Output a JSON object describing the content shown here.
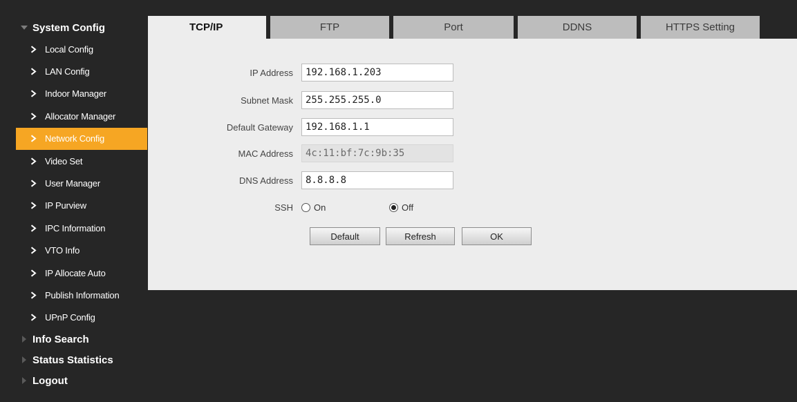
{
  "sidebar": {
    "system_config": "System Config",
    "items": [
      {
        "label": "Local Config"
      },
      {
        "label": "LAN Config"
      },
      {
        "label": "Indoor Manager"
      },
      {
        "label": "Allocator Manager"
      },
      {
        "label": "Network Config"
      },
      {
        "label": "Video Set"
      },
      {
        "label": "User Manager"
      },
      {
        "label": "IP Purview"
      },
      {
        "label": "IPC Information"
      },
      {
        "label": "VTO Info"
      },
      {
        "label": "IP Allocate Auto"
      },
      {
        "label": "Publish Information"
      },
      {
        "label": "UPnP Config"
      }
    ],
    "active_item": "Network Config",
    "info_search": "Info Search",
    "status_statistics": "Status Statistics",
    "logout": "Logout"
  },
  "tabs": [
    {
      "label": "TCP/IP"
    },
    {
      "label": "FTP"
    },
    {
      "label": "Port"
    },
    {
      "label": "DDNS"
    },
    {
      "label": "HTTPS Setting"
    }
  ],
  "active_tab": "TCP/IP",
  "form": {
    "ip_address": {
      "label": "IP Address",
      "value": "192.168.1.203"
    },
    "subnet_mask": {
      "label": "Subnet Mask",
      "value": "255.255.255.0"
    },
    "default_gateway": {
      "label": "Default Gateway",
      "value": "192.168.1.1"
    },
    "mac_address": {
      "label": "MAC Address",
      "value": "4c:11:bf:7c:9b:35"
    },
    "dns_address": {
      "label": "DNS Address",
      "value": "8.8.8.8"
    },
    "ssh": {
      "label": "SSH",
      "on_label": "On",
      "off_label": "Off",
      "selected": "Off"
    }
  },
  "buttons": {
    "default": "Default",
    "refresh": "Refresh",
    "ok": "OK"
  },
  "colors": {
    "accent": "#f6a623",
    "background": "#262626",
    "panel": "#ededed",
    "tab_inactive": "#bdbdbd"
  }
}
